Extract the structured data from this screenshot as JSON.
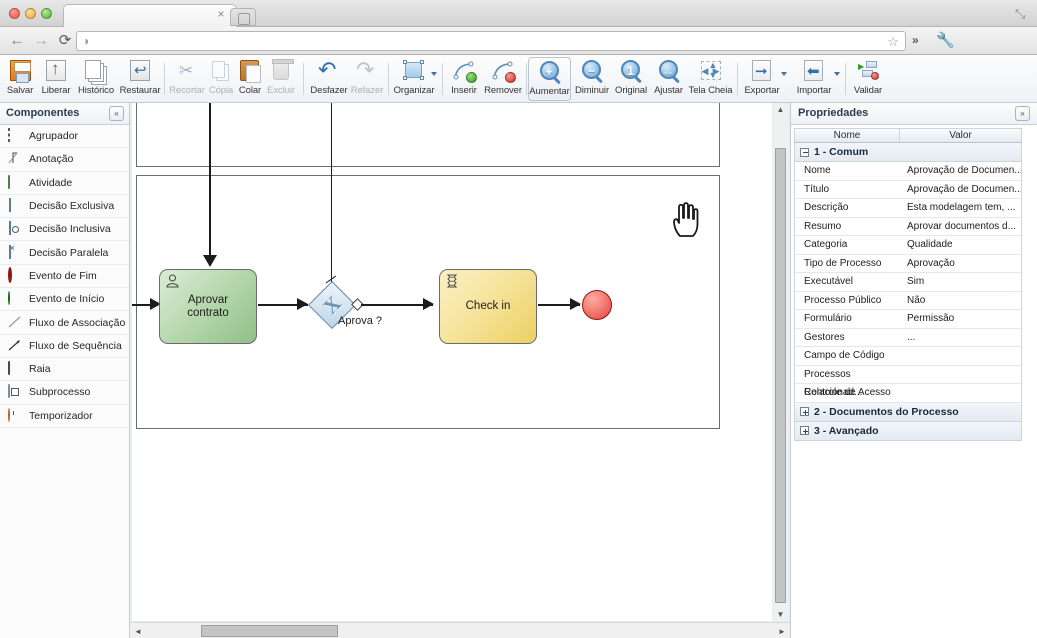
{
  "browser": {
    "tab_title": "",
    "tab_close": "×",
    "url_value": "",
    "url_placeholder": "",
    "back_icon": "←",
    "forward_icon": "→",
    "reload_icon": "⟳",
    "favicon": "◑",
    "star_icon": "☆",
    "chevrons_icon": "»",
    "wrench_icon": "🔧",
    "maximize_icon": "⤡"
  },
  "toolbar": {
    "groups": [
      {
        "items": [
          {
            "label": "Salvar",
            "icon": "save-disk-icon",
            "enabled": true,
            "selected": false
          },
          {
            "label": "Liberar",
            "icon": "publish-up-icon",
            "enabled": true,
            "selected": false
          },
          {
            "label": "Histórico",
            "icon": "history-stack-icon",
            "enabled": true,
            "selected": false
          },
          {
            "label": "Restaurar",
            "icon": "restore-icon",
            "enabled": true,
            "selected": false
          }
        ]
      },
      {
        "items": [
          {
            "label": "Recortar",
            "icon": "scissors-icon",
            "enabled": false,
            "selected": false
          },
          {
            "label": "Cópia",
            "icon": "copy-icon",
            "enabled": false,
            "selected": false
          },
          {
            "label": "Colar",
            "icon": "paste-icon",
            "enabled": true,
            "selected": false
          },
          {
            "label": "Excluir",
            "icon": "trash-icon",
            "enabled": false,
            "selected": false
          }
        ]
      },
      {
        "items": [
          {
            "label": "Desfazer",
            "icon": "undo-arrow-icon",
            "enabled": true,
            "selected": false
          },
          {
            "label": "Refazer",
            "icon": "redo-arrow-icon",
            "enabled": false,
            "selected": false
          }
        ]
      },
      {
        "items": [
          {
            "label": "Organizar",
            "icon": "arrange-icon",
            "enabled": true,
            "selected": false,
            "dropdown": true
          }
        ]
      },
      {
        "items": [
          {
            "label": "Inserir",
            "icon": "insert-point-icon",
            "enabled": true,
            "selected": false
          },
          {
            "label": "Remover",
            "icon": "remove-point-icon",
            "enabled": true,
            "selected": false
          }
        ]
      },
      {
        "items": [
          {
            "label": "Aumentar",
            "icon": "zoom-in-icon",
            "enabled": true,
            "selected": true
          },
          {
            "label": "Diminuir",
            "icon": "zoom-out-icon",
            "enabled": true,
            "selected": false
          },
          {
            "label": "Original",
            "icon": "zoom-original-icon",
            "enabled": true,
            "selected": false
          },
          {
            "label": "Ajustar",
            "icon": "zoom-fit-icon",
            "enabled": true,
            "selected": false
          },
          {
            "label": "Tela Cheia",
            "icon": "fullscreen-icon",
            "enabled": true,
            "selected": false
          }
        ]
      },
      {
        "items": [
          {
            "label": "Exportar",
            "icon": "export-icon",
            "enabled": true,
            "selected": false,
            "dropdown": true
          },
          {
            "label": "Importar",
            "icon": "import-icon",
            "enabled": true,
            "selected": false,
            "dropdown": true
          }
        ]
      },
      {
        "items": [
          {
            "label": "Validar",
            "icon": "validate-icon",
            "enabled": true,
            "selected": false
          }
        ]
      }
    ]
  },
  "sidebar": {
    "title": "Componentes",
    "collapse_icon": "«",
    "items": [
      {
        "label": "Agrupador",
        "icon": "group-box-icon"
      },
      {
        "label": "Anotação",
        "icon": "annotation-icon"
      },
      {
        "label": "Atividade",
        "icon": "activity-icon"
      },
      {
        "label": "Decisão Exclusiva",
        "icon": "exclusive-gateway-icon"
      },
      {
        "label": "Decisão Inclusiva",
        "icon": "inclusive-gateway-icon"
      },
      {
        "label": "Decisão Paralela",
        "icon": "parallel-gateway-icon"
      },
      {
        "label": "Evento de Fim",
        "icon": "end-event-icon"
      },
      {
        "label": "Evento de Início",
        "icon": "start-event-icon"
      },
      {
        "label": "Fluxo de Associação",
        "icon": "association-flow-icon"
      },
      {
        "label": "Fluxo de Sequência",
        "icon": "sequence-flow-icon"
      },
      {
        "label": "Raia",
        "icon": "lane-icon"
      },
      {
        "label": "Subprocesso",
        "icon": "subprocess-icon"
      },
      {
        "label": "Temporizador",
        "icon": "timer-icon"
      }
    ]
  },
  "canvas": {
    "nodes": [
      {
        "id": "aprovar-contrato",
        "label": "Aprovar\ncontrato",
        "type": "manual-task",
        "color": "green"
      },
      {
        "id": "aprova-gateway",
        "label": "Aprova ?",
        "type": "exclusive-gateway",
        "marker": "X"
      },
      {
        "id": "check-in",
        "label": "Check in",
        "type": "script-task",
        "color": "yellow"
      },
      {
        "id": "end-event",
        "label": "",
        "type": "end-event",
        "color": "red"
      }
    ],
    "scroll": {
      "vertical_up_icon": "▲",
      "vertical_down_icon": "▼",
      "horizontal_left_icon": "◄",
      "horizontal_right_icon": "►"
    }
  },
  "properties": {
    "title": "Propriedades",
    "expand_icon": "»",
    "columns": {
      "name": "Nome",
      "value": "Valor"
    },
    "groups": [
      {
        "label": "1 - Comum",
        "expanded": true,
        "rows": [
          {
            "name": "Nome",
            "value": "Aprovação de Documen..."
          },
          {
            "name": "Título",
            "value": "Aprovação de Documen..."
          },
          {
            "name": "Descrição",
            "value": "Esta modelagem tem, ..."
          },
          {
            "name": "Resumo",
            "value": "Aprovar documentos d..."
          },
          {
            "name": "Categoria",
            "value": "Qualidade"
          },
          {
            "name": "Tipo de Processo",
            "value": "Aprovação"
          },
          {
            "name": "Executável",
            "value": "Sim"
          },
          {
            "name": "Processo Público",
            "value": "Não"
          },
          {
            "name": "Formulário",
            "value": "Permissão"
          },
          {
            "name": "Gestores",
            "value": "..."
          },
          {
            "name": "Campo de Código",
            "value": ""
          },
          {
            "name": "Processos Relacionad...",
            "value": ""
          },
          {
            "name": "Controle de Acesso",
            "value": ""
          }
        ]
      },
      {
        "label": "2 - Documentos do Processo",
        "expanded": false,
        "rows": []
      },
      {
        "label": "3 - Avançado",
        "expanded": false,
        "rows": []
      }
    ]
  },
  "colors": {
    "task_green": "#8fc087",
    "task_yellow": "#ecd063",
    "gateway_blue": "#bed6e8",
    "end_event_red": "#e4433a",
    "accent_blue": "#2f6fae"
  }
}
